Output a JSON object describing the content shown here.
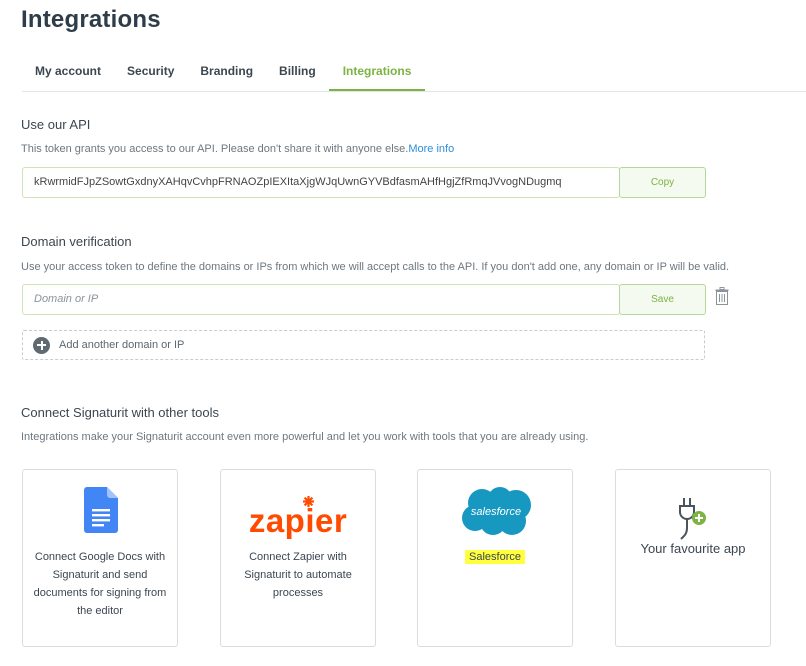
{
  "header": {
    "title": "Integrations"
  },
  "tabs": [
    {
      "label": "My account"
    },
    {
      "label": "Security"
    },
    {
      "label": "Branding"
    },
    {
      "label": "Billing"
    },
    {
      "label": "Integrations",
      "active": true
    }
  ],
  "api": {
    "title": "Use our API",
    "description": "This token grants you access to our API. Please don't share it with anyone else.",
    "more_info": "More info",
    "token": "kRwrmidFJpZSowtGxdnyXAHqvCvhpFRNAOZpIEXItaXjgWJqUwnGYVBdfasmAHfHgjZfRmqJVvogNDugmq",
    "copy_label": "Copy"
  },
  "domain": {
    "title": "Domain verification",
    "description": "Use your access token to define the domains or IPs from which we will accept calls to the API. If you don't add one, any domain or IP will be valid.",
    "placeholder": "Domain or IP",
    "save_label": "Save",
    "add_label": "Add another domain or IP"
  },
  "connect": {
    "title": "Connect Signaturit with other tools",
    "description": "Integrations make your Signaturit account even more powerful and let you work with tools that you are already using."
  },
  "cards": [
    {
      "label": "Connect Google Docs with Signaturit and send documents for signing from the editor",
      "icon": "google-docs-icon"
    },
    {
      "logo": "zapier",
      "label": "Connect Zapier with Signaturit to automate processes",
      "icon": "zapier-logo"
    },
    {
      "logo": "salesforce",
      "label": "Salesforce",
      "icon": "salesforce-logo"
    },
    {
      "label": "Your favourite app",
      "icon": "plug-add-icon"
    }
  ],
  "colors": {
    "accent": "#7cb342",
    "link": "#2f8fd8",
    "highlight": "#ffff3d",
    "zapier": "#ff4a00",
    "salesforce": "#1798c1"
  }
}
